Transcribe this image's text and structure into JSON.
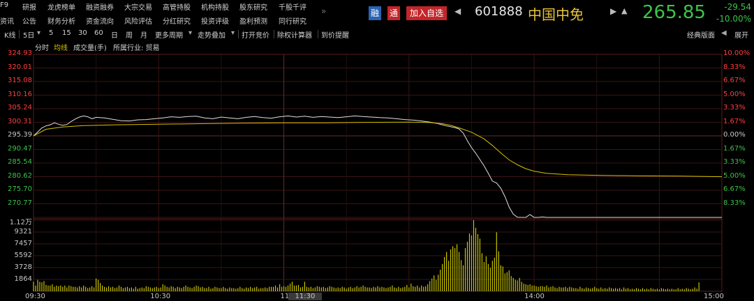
{
  "menu": {
    "row1": [
      "F9",
      "研报",
      "龙虎榜单",
      "融资融券",
      "大宗交易",
      "高管持股",
      "机构持股",
      "股东研究",
      "千股千评"
    ],
    "row2": [
      "资讯",
      "公告",
      "财务分析",
      "资金流向",
      "风险评估",
      "分红研究",
      "投资评级",
      "盈利预测",
      "同行研究"
    ],
    "more": "»"
  },
  "stock": {
    "rong": "融",
    "tong": "通",
    "add_watch": "加入自选",
    "code": "601888",
    "name": "中国中免",
    "price": "265.85",
    "change": "-29.54",
    "change_pct": "-10.00%"
  },
  "toolbar": {
    "kline": "K线",
    "period_select": "5日",
    "items": [
      "5",
      "15",
      "30",
      "60",
      "日",
      "周",
      "月"
    ],
    "more_period": "更多周期",
    "trend_overlay": "走势叠加",
    "open_auction": "打开竞价",
    "xr_calc": "除权计算器",
    "alert": "到价提醒",
    "classic_layout": "经典版面",
    "expand": "展开"
  },
  "subbar": {
    "timeshare": "分时",
    "avg_line": "均线",
    "volume": "成交量(手)",
    "industry": "所属行业: 贸易"
  },
  "colors": {
    "up": "#ff4040",
    "down": "#3ec34a",
    "flat": "#c8c8c8",
    "price_line": "#e0e0e0",
    "avg_line": "#d6c400",
    "volume_bar": "#c8c400",
    "grid": "#3a1414"
  },
  "chart_data": [
    {
      "type": "line",
      "title": "",
      "x_range": [
        "09:30",
        "15:00"
      ],
      "x_ticks": [
        "09:30",
        "10:30",
        "11",
        "11:30",
        "14:00",
        "15:00"
      ],
      "ylim": [
        265.85,
        324.93
      ],
      "prev_close": 295.39,
      "left_ticks": [
        "324.93",
        "320.01",
        "315.08",
        "310.16",
        "305.24",
        "300.31",
        "295.39",
        "290.47",
        "285.54",
        "280.62",
        "275.70",
        "270.77"
      ],
      "right_ticks": [
        "10.00%",
        "8.33%",
        "6.67%",
        "5.00%",
        "3.33%",
        "1.67%",
        "0.00%",
        "1.67%",
        "3.33%",
        "5.00%",
        "6.67%",
        "8.33%"
      ],
      "series": [
        {
          "legend": "分时",
          "points": [
            [
              0,
              295.4
            ],
            [
              2,
              296.8
            ],
            [
              4,
              298.3
            ],
            [
              6,
              299.0
            ],
            [
              8,
              299.4
            ],
            [
              10,
              300.1
            ],
            [
              12,
              299.6
            ],
            [
              14,
              299.2
            ],
            [
              16,
              299.5
            ],
            [
              18,
              300.6
            ],
            [
              20,
              301.5
            ],
            [
              22,
              302.2
            ],
            [
              24,
              302.6
            ],
            [
              26,
              302.3
            ],
            [
              28,
              301.6
            ],
            [
              30,
              302.1
            ],
            [
              34,
              301.9
            ],
            [
              38,
              301.4
            ],
            [
              42,
              300.9
            ],
            [
              46,
              300.8
            ],
            [
              50,
              301.2
            ],
            [
              54,
              301.3
            ],
            [
              58,
              301.6
            ],
            [
              62,
              301.9
            ],
            [
              66,
              302.3
            ],
            [
              70,
              302.1
            ],
            [
              74,
              302.4
            ],
            [
              78,
              302.5
            ],
            [
              82,
              301.9
            ],
            [
              86,
              301.6
            ],
            [
              90,
              302.2
            ],
            [
              94,
              301.9
            ],
            [
              98,
              301.6
            ],
            [
              102,
              302.1
            ],
            [
              106,
              302.4
            ],
            [
              110,
              302.0
            ],
            [
              114,
              301.8
            ],
            [
              118,
              302.3
            ],
            [
              122,
              302.6
            ],
            [
              126,
              302.2
            ],
            [
              130,
              302.5
            ],
            [
              134,
              302.1
            ],
            [
              138,
              302.4
            ],
            [
              142,
              302.2
            ],
            [
              146,
              302.0
            ],
            [
              150,
              302.3
            ],
            [
              154,
              302.6
            ],
            [
              158,
              302.4
            ],
            [
              162,
              302.2
            ],
            [
              166,
              302.0
            ],
            [
              170,
              301.9
            ],
            [
              174,
              301.6
            ],
            [
              178,
              301.3
            ],
            [
              182,
              301.1
            ],
            [
              186,
              300.8
            ],
            [
              190,
              300.4
            ],
            [
              194,
              299.8
            ],
            [
              198,
              299.0
            ],
            [
              202,
              298.4
            ],
            [
              204,
              297.9
            ],
            [
              206,
              296.4
            ],
            [
              208,
              293.6
            ],
            [
              210,
              291.1
            ],
            [
              212,
              289.1
            ],
            [
              214,
              286.8
            ],
            [
              216,
              284.5
            ],
            [
              218,
              281.8
            ],
            [
              220,
              279.0
            ],
            [
              222,
              278.3
            ],
            [
              224,
              276.4
            ],
            [
              226,
              273.4
            ],
            [
              228,
              269.6
            ],
            [
              230,
              267.0
            ],
            [
              232,
              265.9
            ],
            [
              234,
              265.85
            ],
            [
              236,
              265.85
            ],
            [
              238,
              266.9
            ],
            [
              240,
              265.85
            ],
            [
              242,
              265.85
            ],
            [
              244,
              266.0
            ],
            [
              246,
              265.85
            ],
            [
              250,
              265.85
            ],
            [
              300,
              265.85
            ],
            [
              330,
              265.85
            ]
          ]
        },
        {
          "legend": "均线",
          "points": [
            [
              0,
              295.4
            ],
            [
              6,
              297.8
            ],
            [
              14,
              298.6
            ],
            [
              24,
              299.1
            ],
            [
              40,
              299.4
            ],
            [
              60,
              299.6
            ],
            [
              80,
              299.8
            ],
            [
              100,
              300.0
            ],
            [
              120,
              300.1
            ],
            [
              140,
              300.1
            ],
            [
              160,
              300.3
            ],
            [
              180,
              300.4
            ],
            [
              190,
              300.2
            ],
            [
              196,
              299.8
            ],
            [
              200,
              299.2
            ],
            [
              204,
              298.3
            ],
            [
              210,
              296.7
            ],
            [
              216,
              294.3
            ],
            [
              220,
              291.9
            ],
            [
              224,
              289.2
            ],
            [
              228,
              286.7
            ],
            [
              232,
              284.9
            ],
            [
              236,
              283.5
            ],
            [
              240,
              282.6
            ],
            [
              246,
              281.8
            ],
            [
              256,
              281.3
            ],
            [
              270,
              281.1
            ],
            [
              290,
              280.9
            ],
            [
              310,
              280.8
            ],
            [
              330,
              280.6
            ]
          ]
        }
      ]
    },
    {
      "type": "bar",
      "title": "成交量(手)",
      "ylim": [
        0,
        11200
      ],
      "y_ticks": [
        "1.12万",
        "9321",
        "7457",
        "5592",
        "3728",
        "1864"
      ],
      "values": [
        1500,
        900,
        1800,
        1500,
        1400,
        1600,
        1000,
        900,
        900,
        1100,
        700,
        900,
        800,
        900,
        700,
        900,
        600,
        900,
        800,
        700,
        700,
        600,
        800,
        600,
        900,
        700,
        500,
        600,
        800,
        600,
        2000,
        1800,
        1300,
        900,
        700,
        600,
        800,
        600,
        700,
        500,
        600,
        900,
        700,
        500,
        600,
        700,
        500,
        600,
        400,
        700,
        400,
        500,
        600,
        500,
        800,
        700,
        600,
        500,
        600,
        700,
        500,
        600,
        1100,
        900,
        700,
        600,
        800,
        700,
        500,
        700,
        600,
        500,
        700,
        900,
        700,
        600,
        500,
        700,
        900,
        800,
        600,
        700,
        500,
        500,
        700,
        400,
        500,
        700,
        600,
        500,
        500,
        700,
        500,
        400,
        600,
        500,
        500,
        400,
        500,
        700,
        500,
        400,
        600,
        500,
        700,
        500,
        600,
        700,
        400,
        500,
        500,
        600,
        500,
        700,
        700,
        700,
        900,
        600,
        1100,
        700,
        800,
        700,
        900,
        1200,
        1500,
        900,
        900,
        1000,
        600,
        700,
        1500,
        700,
        600,
        700,
        500,
        600,
        800,
        700,
        600,
        700,
        500,
        600,
        800,
        700,
        600,
        500,
        600,
        500,
        700,
        600,
        400,
        600,
        700,
        500,
        600,
        800,
        600,
        700,
        900,
        700,
        600,
        600,
        500,
        700,
        600,
        800,
        600,
        700,
        600,
        500,
        600,
        700,
        900,
        600,
        500,
        700,
        500,
        600,
        700,
        1000,
        600,
        1200,
        800,
        700,
        900,
        600,
        900,
        700,
        800,
        1100,
        1600,
        2000,
        2500,
        1800,
        2600,
        3400,
        4300,
        5400,
        6200,
        4800,
        6600,
        7100,
        6800,
        7400,
        6200,
        4900,
        4100,
        6800,
        7800,
        9100,
        8800,
        11200,
        10000,
        9000,
        8300,
        6000,
        4600,
        5500,
        4300,
        3700,
        4800,
        5300,
        9300,
        6300,
        4100,
        3900,
        2800,
        3000,
        3300,
        2400,
        2100,
        1800,
        1700,
        2100,
        1500,
        1200,
        1100,
        1000,
        1100,
        900,
        900,
        800,
        700,
        800,
        800,
        700,
        900,
        600,
        700,
        800,
        600,
        500,
        700,
        600,
        600,
        700,
        500,
        700,
        600,
        500,
        500,
        400,
        700,
        500,
        400,
        600,
        500,
        400,
        500,
        700,
        500,
        400,
        600,
        400,
        500,
        400,
        600,
        500,
        400,
        500,
        400,
        500,
        300,
        600,
        400,
        500,
        300,
        400,
        300,
        500,
        400,
        300,
        500,
        300,
        400,
        300,
        500,
        400,
        300,
        400,
        300,
        500,
        400,
        300,
        400,
        300,
        400,
        300,
        300,
        500,
        300,
        400,
        300,
        500,
        400,
        300,
        400,
        600,
        400,
        1400
      ]
    }
  ]
}
